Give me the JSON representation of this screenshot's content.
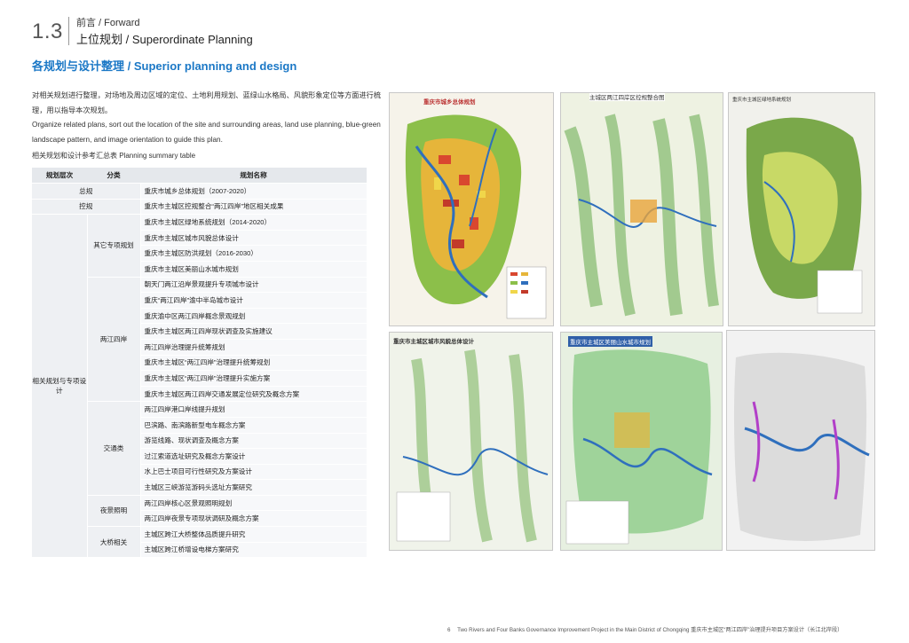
{
  "section": {
    "number": "1.3",
    "top_label": "前言 / Forward",
    "sub_label": "上位规划 / Superordinate Planning"
  },
  "heading": "各规划与设计整理 / Superior planning and design",
  "paragraph": {
    "cn": "对相关规划进行整理，对场地及周边区域的定位、土地利用规划、蓝绿山水格局、风貌形象定位等方面进行梳理，用以指导本次规划。",
    "en": "Organize related plans, sort out the location of the site and surrounding areas, land use planning, blue-green landscape pattern, and image orientation to guide this plan."
  },
  "table_caption": "相关规划和设计参考汇总表 Planning summary table",
  "table": {
    "headers": [
      "规划层次",
      "分类",
      "规划名称"
    ],
    "rows": [
      {
        "level": "总规",
        "category": "",
        "name": "重庆市城乡总体规划（2007-2020）"
      },
      {
        "level": "控规",
        "category": "",
        "name": "重庆市主城区控规整合“两江四岸”地区相关成果"
      },
      {
        "level": "相关规划与专项设计",
        "category": "其它专项规划",
        "name": "重庆市主城区绿地系统规划（2014-2020）"
      },
      {
        "level": "",
        "category": "",
        "name": "重庆市主城区城市风貌总体设计"
      },
      {
        "level": "",
        "category": "",
        "name": "重庆市主城区防洪规划（2016-2030）"
      },
      {
        "level": "",
        "category": "",
        "name": "重庆市主城区美丽山水城市规划"
      },
      {
        "level": "",
        "category": "两江四岸",
        "name": "朝天门两江沿岸景观提升专项城市设计"
      },
      {
        "level": "",
        "category": "",
        "name": "重庆“两江四岸”渝中半岛城市设计"
      },
      {
        "level": "",
        "category": "",
        "name": "重庆渝中区两江四岸概念景观规划"
      },
      {
        "level": "",
        "category": "",
        "name": "重庆市主城区两江四岸现状调查及实施建议"
      },
      {
        "level": "",
        "category": "",
        "name": "两江四岸治理提升统筹规划"
      },
      {
        "level": "",
        "category": "",
        "name": "重庆市主城区“两江四岸”治理提升统筹规划"
      },
      {
        "level": "",
        "category": "",
        "name": "重庆市主城区“两江四岸”治理提升实施方案"
      },
      {
        "level": "",
        "category": "",
        "name": "重庆市主城区两江四岸交通发展定位研究及概念方案"
      },
      {
        "level": "",
        "category": "交通类",
        "name": "两江四岸港口岸线提升规划"
      },
      {
        "level": "",
        "category": "",
        "name": "巴滨路、南滨路新型电车概念方案"
      },
      {
        "level": "",
        "category": "",
        "name": "游览线路、现状调查及概念方案"
      },
      {
        "level": "",
        "category": "",
        "name": "过江索道选址研究及概念方案设计"
      },
      {
        "level": "",
        "category": "",
        "name": "水上巴士项目可行性研究及方案设计"
      },
      {
        "level": "",
        "category": "",
        "name": "主城区三峡游览游码头选址方案研究"
      },
      {
        "level": "",
        "category": "夜景照明",
        "name": "两江四岸核心区景观照明规划"
      },
      {
        "level": "",
        "category": "",
        "name": "两江四岸夜景专项现状调研及概念方案"
      },
      {
        "level": "",
        "category": "大桥相关",
        "name": "主城区跨江大桥整体品质提升研究"
      },
      {
        "level": "",
        "category": "",
        "name": "主城区跨江桥增设电梯方案研究"
      }
    ]
  },
  "maps": [
    {
      "id": "map1",
      "title": "重庆市城乡总体规划",
      "palette": "landuse"
    },
    {
      "id": "map2",
      "title": "主城区两江四岸区控规整合图",
      "palette": "ridges"
    },
    {
      "id": "map3",
      "title": "重庆市主城区绿地系统规划",
      "palette": "greenery"
    },
    {
      "id": "map4",
      "title": "重庆市主城区城市风貌总体设计",
      "palette": "ridges"
    },
    {
      "id": "map5",
      "title": "重庆市主城区美丽山水城市规划",
      "palette": "bluegreen"
    },
    {
      "id": "map6",
      "title": "",
      "palette": "grey"
    }
  ],
  "colors": {
    "accent": "#1b78c6",
    "river": "#2f6fbd",
    "table_header": "#e5e8ec"
  },
  "footer": {
    "page": "6",
    "text": "Two Rivers and Four Banks Governance Improvement Project in the Main District of Chongqing 重庆市主城区“两江四岸”治理提升项目方案设计（长江北岸段）"
  }
}
